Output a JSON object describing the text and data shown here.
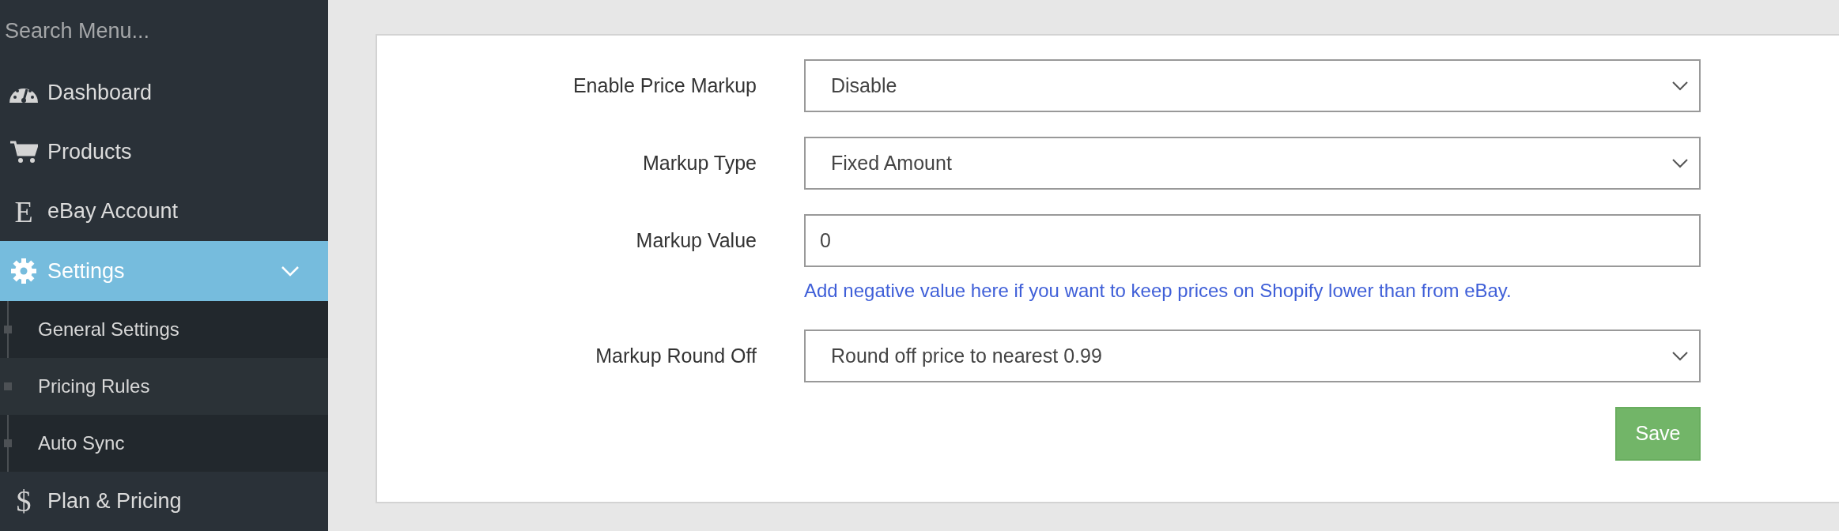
{
  "sidebar": {
    "search": {
      "placeholder": "Search Menu..."
    },
    "items": [
      {
        "label": "Dashboard",
        "kind": "gauge",
        "selected": false
      },
      {
        "label": "Products",
        "kind": "cart",
        "selected": false
      },
      {
        "label": "eBay Account",
        "kind": "letter",
        "icon_text": "E",
        "selected": false
      },
      {
        "label": "Settings",
        "kind": "gear",
        "selected": true,
        "expanded": true,
        "children": [
          {
            "label": "General Settings",
            "selected": false
          },
          {
            "label": "Pricing Rules",
            "selected": true
          },
          {
            "label": "Auto Sync",
            "selected": false
          }
        ]
      },
      {
        "label": "Plan & Pricing",
        "kind": "letter",
        "icon_text": "$",
        "selected": false
      }
    ]
  },
  "form": {
    "fields": [
      {
        "label": "Enable Price Markup",
        "kind": "select",
        "value": "Disable"
      },
      {
        "label": "Markup Type",
        "kind": "select",
        "value": "Fixed Amount"
      },
      {
        "label": "Markup Value",
        "kind": "input",
        "value": "0",
        "help": "Add negative value here if you want to keep prices on Shopify lower than from eBay."
      },
      {
        "label": "Markup Round Off",
        "kind": "select",
        "value": "Round off price to nearest 0.99"
      }
    ],
    "buttons": [
      "Save"
    ]
  }
}
